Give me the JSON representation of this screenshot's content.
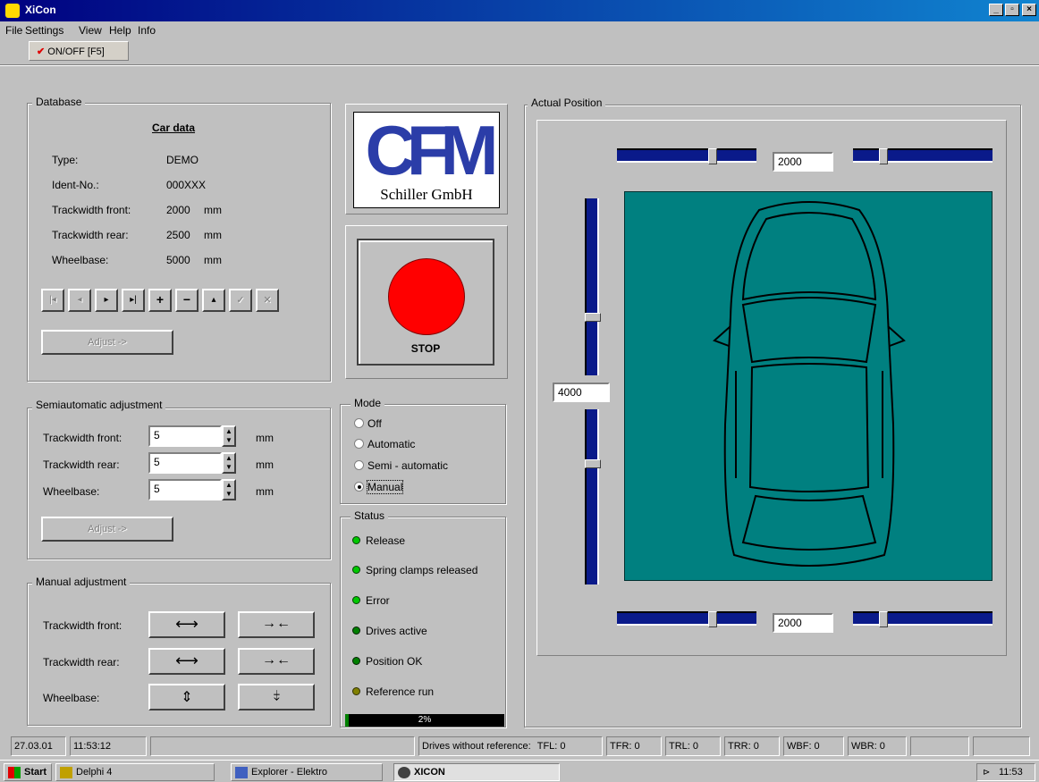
{
  "window": {
    "title": "XiCon"
  },
  "menu": [
    "File",
    "Settings",
    "View",
    "Help",
    "Info"
  ],
  "toolbar": {
    "onoff_label": "ON/OFF  [F5]"
  },
  "database": {
    "group_label": "Database",
    "heading": "Car data",
    "rows": [
      {
        "label": "Type:",
        "value": "DEMO",
        "unit": ""
      },
      {
        "label": "Ident-No.:",
        "value": "000XXX",
        "unit": ""
      },
      {
        "label": "Trackwidth front:",
        "value": "2000",
        "unit": "mm"
      },
      {
        "label": "Trackwidth rear:",
        "value": "2500",
        "unit": "mm"
      },
      {
        "label": "Wheelbase:",
        "value": "5000",
        "unit": "mm"
      }
    ],
    "adjust_label": "Adjust ->"
  },
  "semi": {
    "group_label": "Semiautomatic adjustment",
    "rows": [
      {
        "label": "Trackwidth front:",
        "value": "5",
        "unit": "mm"
      },
      {
        "label": "Trackwidth rear:",
        "value": "5",
        "unit": "mm"
      },
      {
        "label": "Wheelbase:",
        "value": "5",
        "unit": "mm"
      }
    ],
    "adjust_label": "Adjust ->"
  },
  "manual": {
    "group_label": "Manual adjustment",
    "rows": [
      {
        "label": "Trackwidth front:",
        "btn1": "⟷",
        "btn2": "→←"
      },
      {
        "label": "Trackwidth rear:",
        "btn1": "⟷",
        "btn2": "→←"
      },
      {
        "label": "Wheelbase:",
        "btn1": "⇕",
        "btn2": "⤈"
      }
    ]
  },
  "logo": {
    "letters": "CFM",
    "company": "Schiller GmbH"
  },
  "stop": {
    "label": "STOP"
  },
  "mode": {
    "group_label": "Mode",
    "options": [
      "Off",
      "Automatic",
      "Semi - automatic",
      "Manual"
    ],
    "selected": "Manual"
  },
  "status": {
    "group_label": "Status",
    "items": [
      {
        "label": "Release",
        "color": "#00c800"
      },
      {
        "label": "Spring clamps released",
        "color": "#00c800"
      },
      {
        "label": "Error",
        "color": "#00c800"
      },
      {
        "label": "Drives active",
        "color": "#008000"
      },
      {
        "label": "Position OK",
        "color": "#008000"
      },
      {
        "label": "Reference run",
        "color": "#808000"
      }
    ],
    "progress_label": "2%",
    "progress": 0.02
  },
  "position": {
    "group_label": "Actual Position",
    "top_value": "2000",
    "left_value": "4000",
    "bottom_value": "2000",
    "top_left_level": 0.3,
    "top_right_level": 0.2,
    "bottom_left_level": 0.3,
    "bottom_right_level": 0.2,
    "left_top_level": 0.68,
    "left_bottom_level": 0.3
  },
  "statusbar": {
    "date": "27.03.01",
    "time": "11:53:12",
    "drives_label": "Drives without reference:",
    "tfl": "TFL: 0",
    "tfr": "TFR: 0",
    "trl": "TRL: 0",
    "trr": "TRR: 0",
    "wbf": "WBF: 0",
    "wbr": "WBR: 0"
  },
  "taskbar": {
    "start": "Start",
    "items": [
      "Delphi 4",
      "Explorer - Elektro",
      "XICON"
    ],
    "clock": "11:53"
  },
  "colors": {
    "titlebar": "#000080",
    "canvas": "#008080",
    "stop": "#ff0000",
    "slider": "#0a1a8a"
  }
}
